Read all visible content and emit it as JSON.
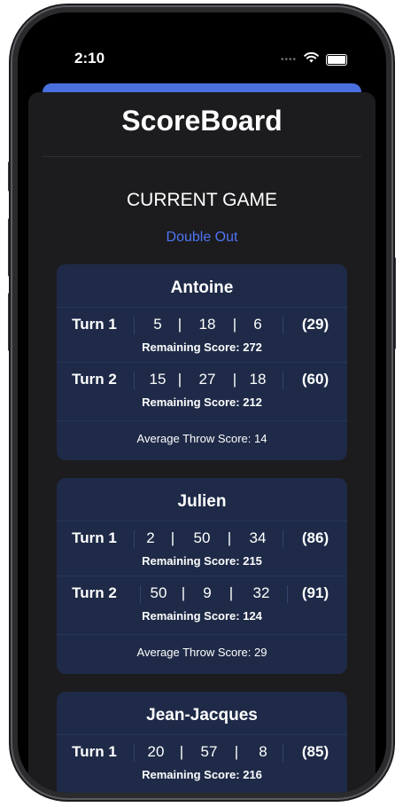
{
  "status": {
    "time": "2:10"
  },
  "app": {
    "title": "ScoreBoard"
  },
  "game": {
    "section_title": "CURRENT GAME",
    "mode": "Double Out"
  },
  "players": [
    {
      "name": "Antoine",
      "turns": [
        {
          "label": "Turn 1",
          "throws": [
            "5",
            "18",
            "6"
          ],
          "total": "(29)",
          "remaining": "Remaining Score: 272"
        },
        {
          "label": "Turn 2",
          "throws": [
            "15",
            "27",
            "18"
          ],
          "total": "(60)",
          "remaining": "Remaining Score: 212"
        }
      ],
      "average": "Average Throw Score: 14"
    },
    {
      "name": "Julien",
      "turns": [
        {
          "label": "Turn 1",
          "throws": [
            "2",
            "50",
            "34"
          ],
          "total": "(86)",
          "remaining": "Remaining Score: 215"
        },
        {
          "label": "Turn 2",
          "throws": [
            "50",
            "9",
            "32"
          ],
          "total": "(91)",
          "remaining": "Remaining Score: 124"
        }
      ],
      "average": "Average Throw Score: 29"
    },
    {
      "name": "Jean-Jacques",
      "turns": [
        {
          "label": "Turn 1",
          "throws": [
            "20",
            "57",
            "8"
          ],
          "total": "(85)",
          "remaining": "Remaining Score: 216"
        }
      ]
    }
  ],
  "colors": {
    "accent": "#4f74f4",
    "card": "#1e2a47",
    "sheet": "#1c1c1e"
  },
  "icons": {
    "wifi": "wifi-icon",
    "battery": "battery-icon",
    "signal": "cellular-signal-icon"
  }
}
